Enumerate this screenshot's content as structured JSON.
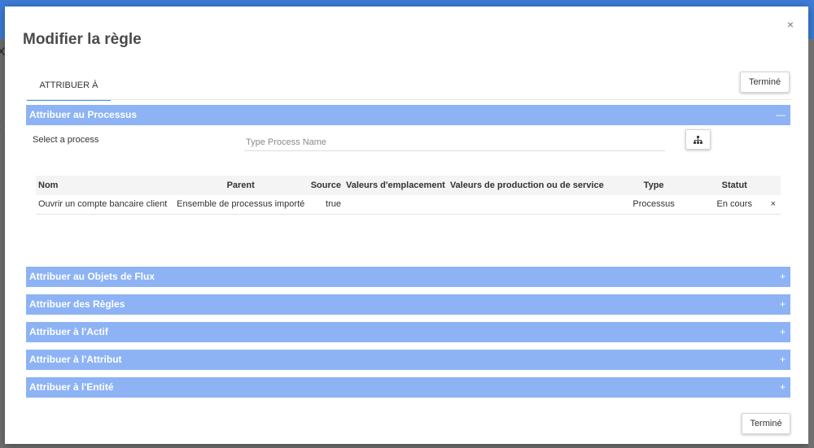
{
  "dialog": {
    "title": "Modifier la règle",
    "close_icon": "×",
    "tab_label": "ATTRIBUER À",
    "done_label_top": "Terminé",
    "done_label_bottom": "Terminé"
  },
  "process_section": {
    "header": "Attribuer au Processus",
    "expanded": true,
    "toggle_symbol": "—",
    "select_label": "Select a process",
    "input_placeholder": "Type Process Name",
    "input_value": "",
    "hierarchy_icon": "hierarchy-icon",
    "table": {
      "columns": [
        "Nom",
        "Parent",
        "Source",
        "Valeurs d'emplacement",
        "Valeurs de production ou de service",
        "Type",
        "Statut"
      ],
      "rows": [
        {
          "nom": "Ouvrir un compte bancaire client",
          "parent": "Ensemble de processus importé",
          "source": "true",
          "valeurs_emplacement": "",
          "valeurs_production": "",
          "type": "Processus",
          "statut": "En cours",
          "remove": "×"
        }
      ]
    }
  },
  "collapsed_sections": [
    {
      "header": "Attribuer au Objets de Flux",
      "toggle_symbol": "+"
    },
    {
      "header": "Attribuer des Règles",
      "toggle_symbol": "+"
    },
    {
      "header": "Attribuer à l'Actif",
      "toggle_symbol": "+"
    },
    {
      "header": "Attribuer à l'Attribut",
      "toggle_symbol": "+"
    },
    {
      "header": "Attribuer à l'Entité",
      "toggle_symbol": "+"
    }
  ],
  "colors": {
    "accent_header": "#8db3f5",
    "tab_underline": "#4a8fe0",
    "top_bar": "#3d7bd6"
  },
  "background": {
    "close_glyph": "X"
  }
}
